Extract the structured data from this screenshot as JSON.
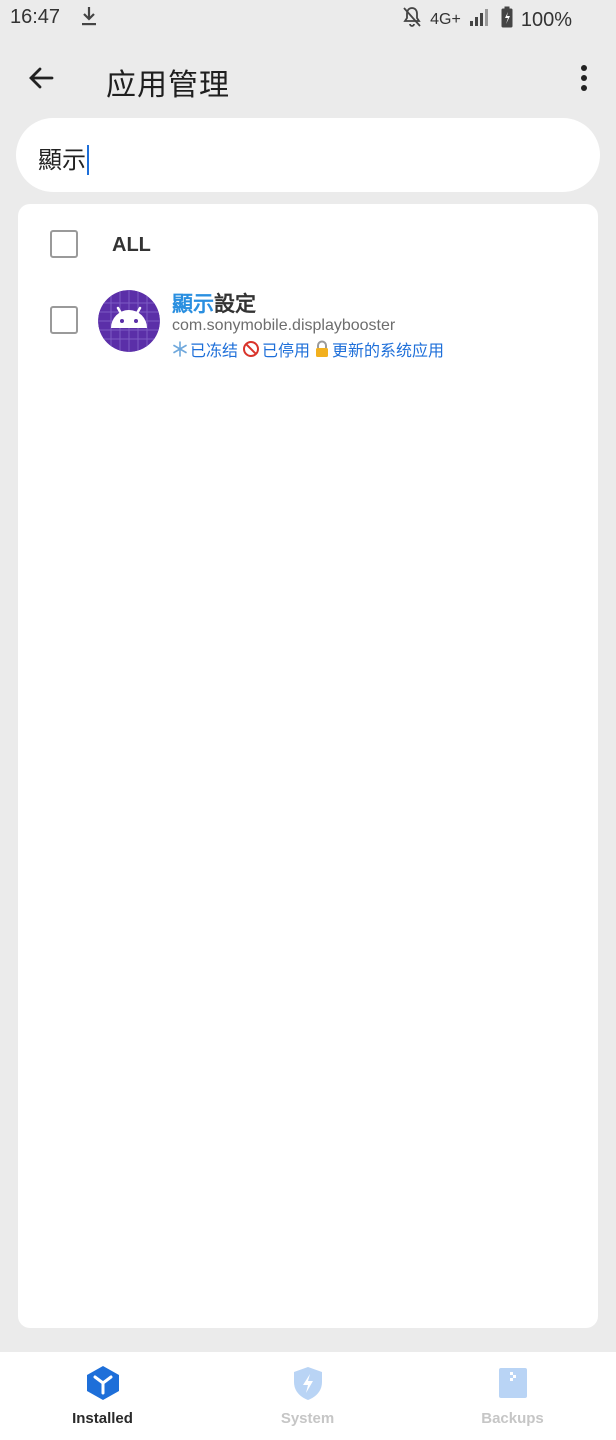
{
  "status_bar": {
    "time": "16:47",
    "network": "4G+",
    "battery": "100%",
    "icons": [
      "download-icon",
      "bell-off-icon",
      "signal-icon",
      "battery-icon"
    ]
  },
  "app_bar": {
    "title": "应用管理",
    "back_icon": "arrow-left-icon",
    "more_icon": "more-vert-icon"
  },
  "search": {
    "query": "顯示"
  },
  "list": {
    "all_label": "ALL",
    "items": [
      {
        "name_highlight": "顯示",
        "name_rest": "設定",
        "package": "com.sonymobile.displaybooster",
        "icon": "android-icon",
        "tags": [
          {
            "icon": "snowflake-icon",
            "label": "已冻结"
          },
          {
            "icon": "prohibited-icon",
            "label": "已停用"
          },
          {
            "icon": "lock-icon",
            "label": "更新的系统应用"
          }
        ]
      }
    ]
  },
  "bottom_nav": {
    "items": [
      {
        "label": "Installed",
        "icon": "box-icon",
        "active": true
      },
      {
        "label": "System",
        "icon": "shield-bolt-icon",
        "active": false
      },
      {
        "label": "Backups",
        "icon": "archive-icon",
        "active": false
      }
    ]
  },
  "colors": {
    "accent": "#1e6fd9",
    "highlight": "#2a8fe0",
    "app_icon_bg": "#5b2fa8",
    "background": "#ebebeb"
  }
}
